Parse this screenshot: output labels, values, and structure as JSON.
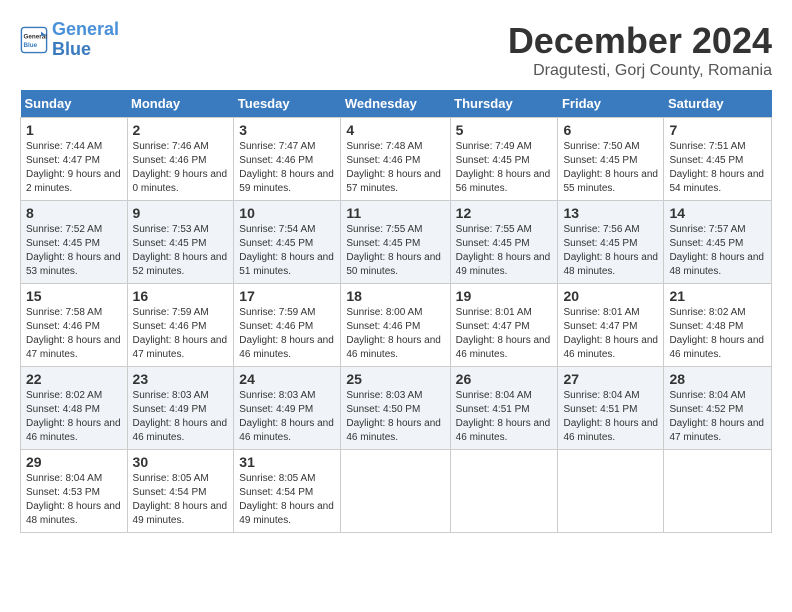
{
  "header": {
    "logo_line1": "General",
    "logo_line2": "Blue",
    "month_title": "December 2024",
    "subtitle": "Dragutesti, Gorj County, Romania"
  },
  "days_of_week": [
    "Sunday",
    "Monday",
    "Tuesday",
    "Wednesday",
    "Thursday",
    "Friday",
    "Saturday"
  ],
  "weeks": [
    [
      {
        "day": "1",
        "sunrise": "7:44 AM",
        "sunset": "4:47 PM",
        "daylight": "9 hours and 2 minutes."
      },
      {
        "day": "2",
        "sunrise": "7:46 AM",
        "sunset": "4:46 PM",
        "daylight": "9 hours and 0 minutes."
      },
      {
        "day": "3",
        "sunrise": "7:47 AM",
        "sunset": "4:46 PM",
        "daylight": "8 hours and 59 minutes."
      },
      {
        "day": "4",
        "sunrise": "7:48 AM",
        "sunset": "4:46 PM",
        "daylight": "8 hours and 57 minutes."
      },
      {
        "day": "5",
        "sunrise": "7:49 AM",
        "sunset": "4:45 PM",
        "daylight": "8 hours and 56 minutes."
      },
      {
        "day": "6",
        "sunrise": "7:50 AM",
        "sunset": "4:45 PM",
        "daylight": "8 hours and 55 minutes."
      },
      {
        "day": "7",
        "sunrise": "7:51 AM",
        "sunset": "4:45 PM",
        "daylight": "8 hours and 54 minutes."
      }
    ],
    [
      {
        "day": "8",
        "sunrise": "7:52 AM",
        "sunset": "4:45 PM",
        "daylight": "8 hours and 53 minutes."
      },
      {
        "day": "9",
        "sunrise": "7:53 AM",
        "sunset": "4:45 PM",
        "daylight": "8 hours and 52 minutes."
      },
      {
        "day": "10",
        "sunrise": "7:54 AM",
        "sunset": "4:45 PM",
        "daylight": "8 hours and 51 minutes."
      },
      {
        "day": "11",
        "sunrise": "7:55 AM",
        "sunset": "4:45 PM",
        "daylight": "8 hours and 50 minutes."
      },
      {
        "day": "12",
        "sunrise": "7:55 AM",
        "sunset": "4:45 PM",
        "daylight": "8 hours and 49 minutes."
      },
      {
        "day": "13",
        "sunrise": "7:56 AM",
        "sunset": "4:45 PM",
        "daylight": "8 hours and 48 minutes."
      },
      {
        "day": "14",
        "sunrise": "7:57 AM",
        "sunset": "4:45 PM",
        "daylight": "8 hours and 48 minutes."
      }
    ],
    [
      {
        "day": "15",
        "sunrise": "7:58 AM",
        "sunset": "4:46 PM",
        "daylight": "8 hours and 47 minutes."
      },
      {
        "day": "16",
        "sunrise": "7:59 AM",
        "sunset": "4:46 PM",
        "daylight": "8 hours and 47 minutes."
      },
      {
        "day": "17",
        "sunrise": "7:59 AM",
        "sunset": "4:46 PM",
        "daylight": "8 hours and 46 minutes."
      },
      {
        "day": "18",
        "sunrise": "8:00 AM",
        "sunset": "4:46 PM",
        "daylight": "8 hours and 46 minutes."
      },
      {
        "day": "19",
        "sunrise": "8:01 AM",
        "sunset": "4:47 PM",
        "daylight": "8 hours and 46 minutes."
      },
      {
        "day": "20",
        "sunrise": "8:01 AM",
        "sunset": "4:47 PM",
        "daylight": "8 hours and 46 minutes."
      },
      {
        "day": "21",
        "sunrise": "8:02 AM",
        "sunset": "4:48 PM",
        "daylight": "8 hours and 46 minutes."
      }
    ],
    [
      {
        "day": "22",
        "sunrise": "8:02 AM",
        "sunset": "4:48 PM",
        "daylight": "8 hours and 46 minutes."
      },
      {
        "day": "23",
        "sunrise": "8:03 AM",
        "sunset": "4:49 PM",
        "daylight": "8 hours and 46 minutes."
      },
      {
        "day": "24",
        "sunrise": "8:03 AM",
        "sunset": "4:49 PM",
        "daylight": "8 hours and 46 minutes."
      },
      {
        "day": "25",
        "sunrise": "8:03 AM",
        "sunset": "4:50 PM",
        "daylight": "8 hours and 46 minutes."
      },
      {
        "day": "26",
        "sunrise": "8:04 AM",
        "sunset": "4:51 PM",
        "daylight": "8 hours and 46 minutes."
      },
      {
        "day": "27",
        "sunrise": "8:04 AM",
        "sunset": "4:51 PM",
        "daylight": "8 hours and 46 minutes."
      },
      {
        "day": "28",
        "sunrise": "8:04 AM",
        "sunset": "4:52 PM",
        "daylight": "8 hours and 47 minutes."
      }
    ],
    [
      {
        "day": "29",
        "sunrise": "8:04 AM",
        "sunset": "4:53 PM",
        "daylight": "8 hours and 48 minutes."
      },
      {
        "day": "30",
        "sunrise": "8:05 AM",
        "sunset": "4:54 PM",
        "daylight": "8 hours and 49 minutes."
      },
      {
        "day": "31",
        "sunrise": "8:05 AM",
        "sunset": "4:54 PM",
        "daylight": "8 hours and 49 minutes."
      },
      null,
      null,
      null,
      null
    ]
  ]
}
